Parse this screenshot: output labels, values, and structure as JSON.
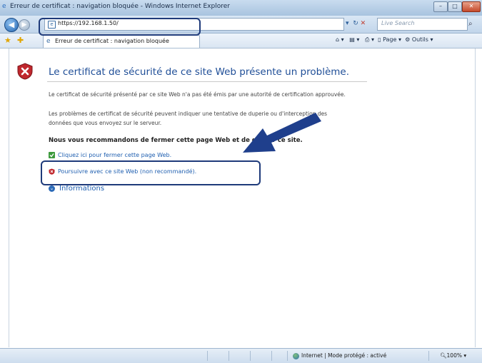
{
  "window": {
    "title": "Erreur de certificat : navigation bloquée - Windows Internet Explorer"
  },
  "address": {
    "url": "https://192.168.1.50/",
    "search_placeholder": "Live Search"
  },
  "tab": {
    "label": "Erreur de certificat : navigation bloquée"
  },
  "commandbar": {
    "page": "Page",
    "tools": "Outils"
  },
  "content": {
    "heading": "Le certificat de sécurité de ce site Web présente un problème.",
    "para1": "Le certificat de sécurité présenté par ce site Web n'a pas été émis par une autorité de certification approuvée.",
    "para2_line1": "Les problèmes de certificat de sécurité peuvent indiquer une tentative de duperie ou d'interception des",
    "para2_line2": "données que vous envoyez sur le serveur.",
    "recommend": "Nous vous recommandons de fermer cette page Web et de quitter ce site.",
    "close_link": "Cliquez ici pour fermer cette page Web.",
    "continue_link": "Poursuivre avec ce site Web (non recommandé).",
    "info_link": "Informations"
  },
  "status": {
    "zone": "Internet | Mode protégé : activé",
    "zoom": "100%"
  },
  "colors": {
    "accent": "#1f5fb0",
    "callout": "#1e3a7a",
    "arrow": "#1f3f8c",
    "shield": "#c0272d"
  }
}
